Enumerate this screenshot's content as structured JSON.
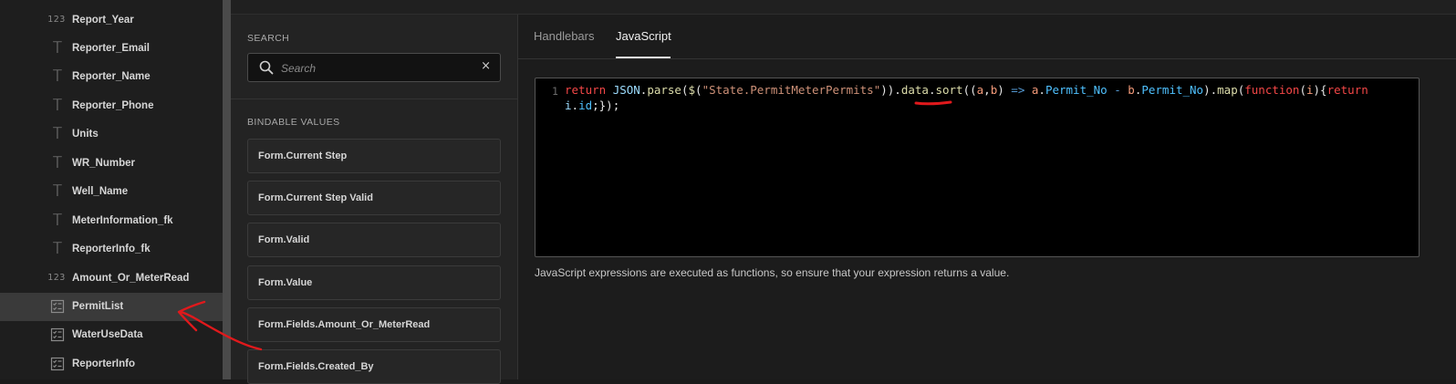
{
  "fields": [
    {
      "type": "number",
      "icon": "number-icon",
      "icon_text": "123",
      "label": "Report_Year"
    },
    {
      "type": "text",
      "icon": "text-icon",
      "icon_text": "T",
      "label": "Reporter_Email"
    },
    {
      "type": "text",
      "icon": "text-icon",
      "icon_text": "T",
      "label": "Reporter_Name"
    },
    {
      "type": "text",
      "icon": "text-icon",
      "icon_text": "T",
      "label": "Reporter_Phone"
    },
    {
      "type": "text",
      "icon": "text-icon",
      "icon_text": "T",
      "label": "Units"
    },
    {
      "type": "text",
      "icon": "text-icon",
      "icon_text": "T",
      "label": "WR_Number"
    },
    {
      "type": "text",
      "icon": "text-icon",
      "icon_text": "T",
      "label": "Well_Name"
    },
    {
      "type": "text",
      "icon": "text-icon",
      "icon_text": "T",
      "label": "MeterInformation_fk"
    },
    {
      "type": "text",
      "icon": "text-icon",
      "icon_text": "T",
      "label": "ReporterInfo_fk"
    },
    {
      "type": "number",
      "icon": "number-icon",
      "icon_text": "123",
      "label": "Amount_Or_MeterRead"
    },
    {
      "type": "list",
      "icon": "list-icon",
      "icon_text": "",
      "label": "PermitList",
      "selected": true
    },
    {
      "type": "list",
      "icon": "list-icon",
      "icon_text": "",
      "label": "WaterUseData"
    },
    {
      "type": "list",
      "icon": "list-icon",
      "icon_text": "",
      "label": "ReporterInfo"
    }
  ],
  "search": {
    "heading": "SEARCH",
    "placeholder": "Search",
    "value": "",
    "clear_label": "×"
  },
  "bindable": {
    "heading": "BINDABLE VALUES",
    "items": [
      "Form.Current Step",
      "Form.Current Step Valid",
      "Form.Valid",
      "Form.Value",
      "Form.Fields.Amount_Or_MeterRead",
      "Form.Fields.Created_By"
    ]
  },
  "editor": {
    "tabs": [
      "Handlebars",
      "JavaScript"
    ],
    "active_tab": "JavaScript",
    "line_number": "1",
    "code_line1_tokens": [
      [
        "k",
        "return "
      ],
      [
        "id",
        "JSON"
      ],
      [
        "pl",
        "."
      ],
      [
        "f",
        "parse"
      ],
      [
        "pl",
        "("
      ],
      [
        "f",
        "$"
      ],
      [
        "pl",
        "("
      ],
      [
        "str",
        "\"State.PermitMeterPermits\""
      ],
      [
        "pl",
        "))"
      ],
      [
        "pl",
        "."
      ],
      [
        "f",
        "data"
      ],
      [
        "pl",
        "."
      ],
      [
        "f",
        "sort"
      ],
      [
        "pl",
        "(("
      ],
      [
        "pa",
        "a"
      ],
      [
        "pl",
        ","
      ],
      [
        "pa",
        "b"
      ],
      [
        "pl",
        ") "
      ],
      [
        "op",
        "=>"
      ],
      [
        "pl",
        " "
      ],
      [
        "pa",
        "a"
      ],
      [
        "pl",
        "."
      ],
      [
        "pr",
        "Permit_No"
      ],
      [
        "pl",
        " "
      ],
      [
        "op",
        "-"
      ],
      [
        "pl",
        " "
      ],
      [
        "pa",
        "b"
      ],
      [
        "pl",
        "."
      ],
      [
        "pr",
        "Permit_No"
      ],
      [
        "pl",
        ")."
      ],
      [
        "f",
        "map"
      ],
      [
        "pl",
        "("
      ],
      [
        "k",
        "function"
      ],
      [
        "pl",
        "("
      ],
      [
        "pa",
        "i"
      ],
      [
        "pl",
        "){"
      ],
      [
        "k",
        "return"
      ]
    ],
    "code_line2_tokens": [
      [
        "id",
        "i"
      ],
      [
        "pl",
        "."
      ],
      [
        "pr",
        "id"
      ],
      [
        "pl",
        ";});"
      ]
    ],
    "help_text": "JavaScript expressions are executed as functions, so ensure that your expression returns a value."
  },
  "colors": {
    "annotation_red": "#e0191c",
    "keyword": "#f44747",
    "string": "#ce9178",
    "function": "#dcdcaa"
  }
}
